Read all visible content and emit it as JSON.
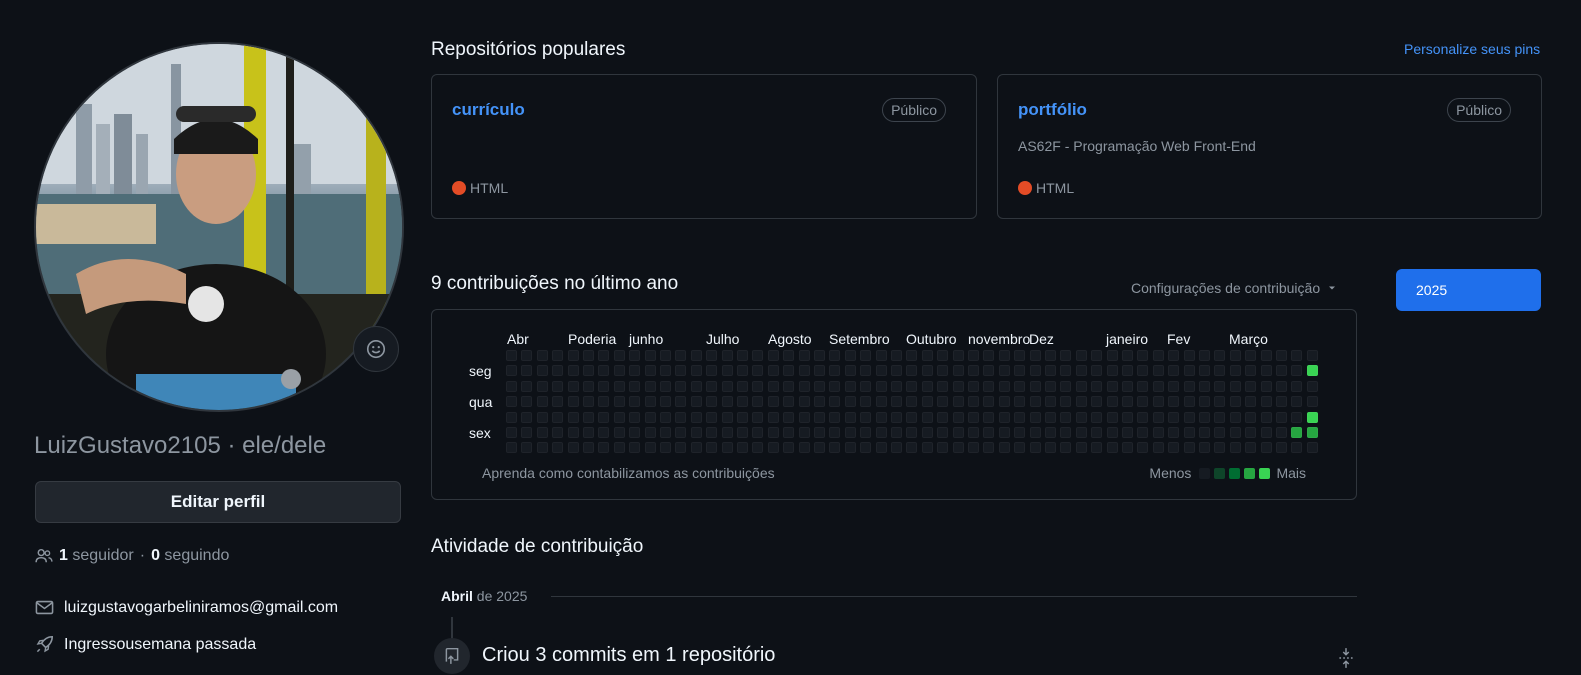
{
  "profile": {
    "username": "LuizGustavo2105",
    "pronouns": "ele/dele",
    "separator": " · ",
    "edit_button": "Editar perfil",
    "followers_count": "1",
    "followers_label": "seguidor",
    "following_count": "0",
    "following_label": "seguindo",
    "dot": " · ",
    "email": "luizgustavogarbeliniramos@gmail.com",
    "joined": "Ingressousemana passada"
  },
  "repos": {
    "title": "Repositórios populares",
    "customize_link": "Personalize seus pins",
    "items": [
      {
        "name": "currículo",
        "badge": "Público",
        "description": "",
        "language": "HTML",
        "language_color": "#e34c26"
      },
      {
        "name": "portfólio",
        "badge": "Público",
        "description": "AS62F - Programação Web Front-End",
        "language": "HTML",
        "language_color": "#e34c26"
      }
    ]
  },
  "contributions": {
    "title": "9 contribuições no último ano",
    "settings_label": "Configurações de contribuição",
    "year": "2025",
    "months": [
      "Abr",
      "Poderia",
      "junho",
      "Julho",
      "Agosto",
      "Setembro",
      "Outubro",
      "novembro",
      "Dez",
      "janeiro",
      "Fev",
      "Março"
    ],
    "days": [
      "seg",
      "qua",
      "sex"
    ],
    "learn_link": "Aprenda como contabilizamos as contribuições",
    "legend_less": "Menos",
    "legend_more": "Mais",
    "level_colors": [
      "#161b22",
      "#0e4429",
      "#006d32",
      "#26a641",
      "#39d353"
    ],
    "active_cells": [
      {
        "week": 52,
        "day": 1,
        "level": 4
      },
      {
        "week": 52,
        "day": 4,
        "level": 4
      },
      {
        "week": 51,
        "day": 5,
        "level": 3
      },
      {
        "week": 52,
        "day": 5,
        "level": 3
      }
    ]
  },
  "activity": {
    "title": "Atividade de contribuição",
    "month": "Abril",
    "year_suffix": "de 2025",
    "item_text": "Criou 3 commits em 1 repositório"
  },
  "icons": {
    "emoji": "smiley-icon",
    "people": "people-icon",
    "mail": "mail-icon",
    "rocket": "rocket-icon",
    "repo_push": "repo-push-icon",
    "fold": "fold-icon",
    "caret": "caret-down-icon"
  }
}
